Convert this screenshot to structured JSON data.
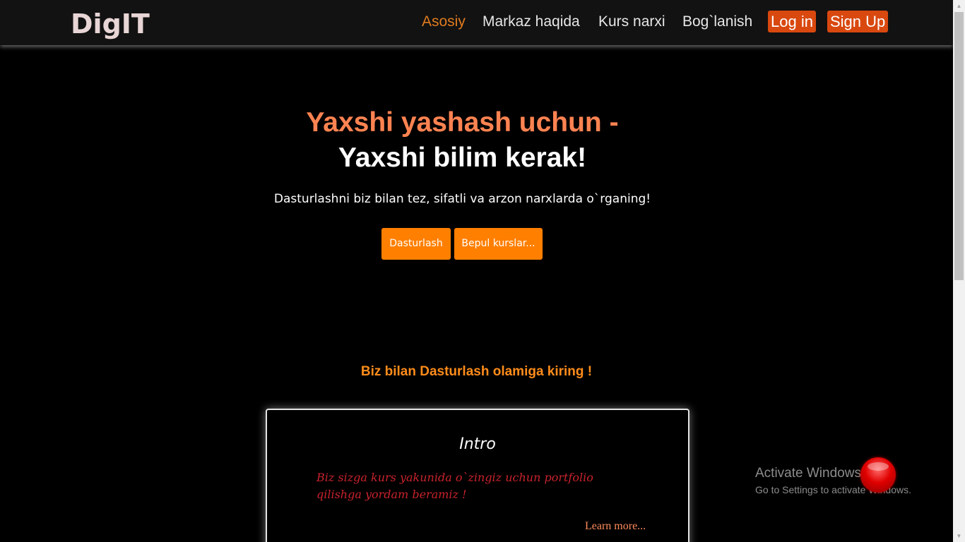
{
  "navbar": {
    "logo": "DigIT",
    "links": [
      "Asosiy",
      "Markaz haqida",
      "Kurs narxi",
      "Bog`lanish"
    ],
    "login_label": "Log in",
    "signup_label": "Sign Up"
  },
  "hero": {
    "line1": "Yaxshi yashash uchun -",
    "line2": "Yaxshi bilim kerak!",
    "subtitle": "Dasturlashni biz bilan tez, sifatli va arzon narxlarda o`rganing!",
    "btn_primary": "Dasturlash",
    "btn_secondary": "Bepul kurslar..."
  },
  "section": {
    "title": "Biz bilan Dasturlash olamiga kiring !"
  },
  "card": {
    "title": "Intro",
    "text": "Biz sizga kurs yakunida o`zingiz uchun portfolio qilishga yordam beramiz !",
    "link": "Learn more..."
  },
  "watermark": {
    "title": "Activate Windows",
    "subtitle": "Go to Settings to activate Windows."
  },
  "colors": {
    "accent_orange": "#ff7f00",
    "nav_button": "#d9480f",
    "hero_highlight": "#ff8351",
    "card_text": "#c8232c"
  },
  "icons": {
    "scroll_up": "chevron-up-icon",
    "scroll_down": "chevron-down-icon",
    "floating_ball": "red-ball-icon"
  }
}
